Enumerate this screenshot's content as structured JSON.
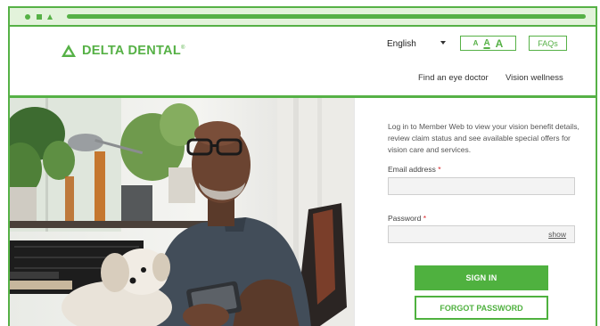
{
  "brand": {
    "name": "DELTA DENTAL",
    "trademark": "®",
    "color": "#56b146"
  },
  "header": {
    "language": "English",
    "text_size": [
      "A",
      "A",
      "A"
    ],
    "faqs": "FAQs",
    "nav": [
      "Find an eye doctor",
      "Vision wellness"
    ]
  },
  "hero": {
    "description": "Man with glasses holding a phone and a small white dog"
  },
  "login": {
    "intro": "Log in to Member Web to view your vision benefit details, review claim status and see available special offers for vision care and services.",
    "email_label": "Email address",
    "password_label": "Password",
    "required_mark": "*",
    "email_value": "",
    "password_value": "",
    "show_label": "show",
    "sign_in": "SIGN IN",
    "forgot": "FORGOT PASSWORD"
  }
}
